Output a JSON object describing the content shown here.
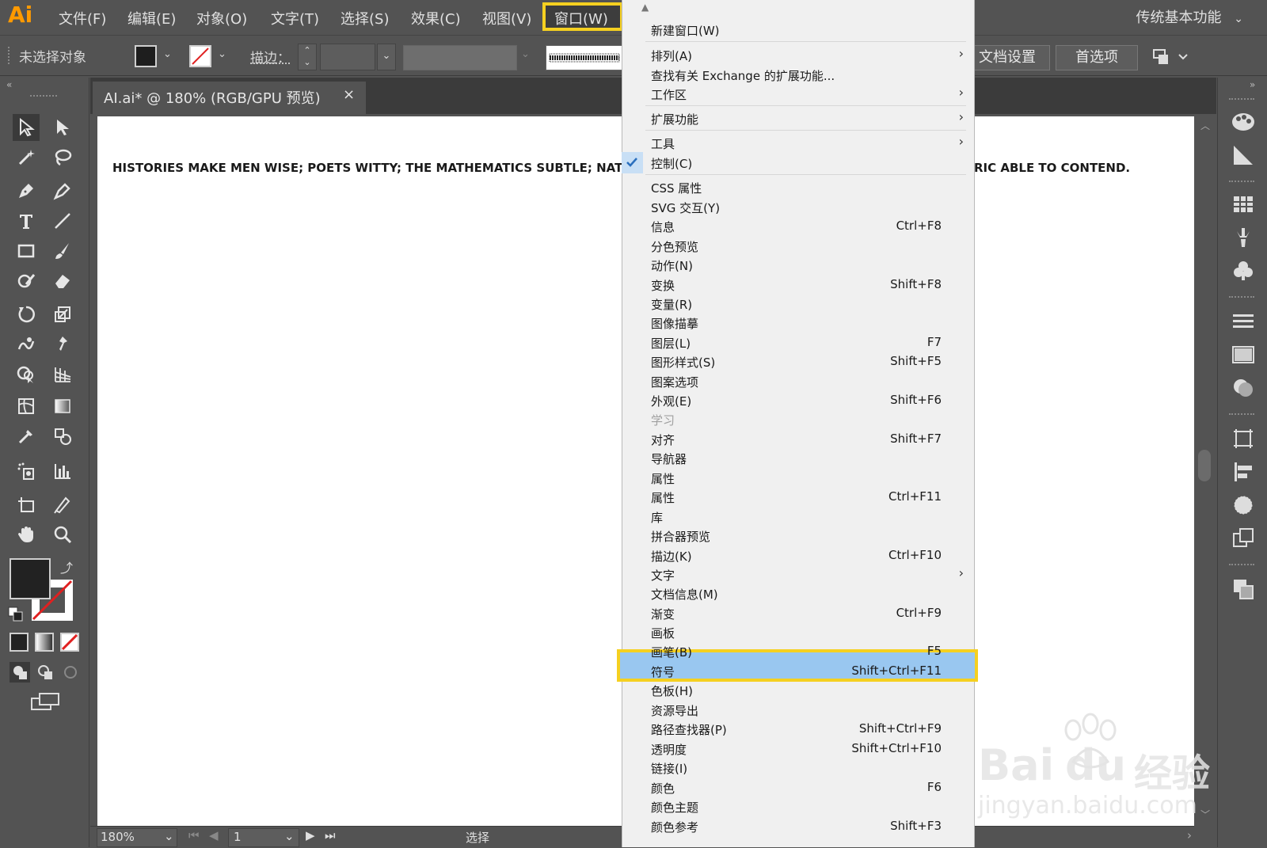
{
  "menubar": {
    "logo": "Ai",
    "items": [
      "文件(F)",
      "编辑(E)",
      "对象(O)",
      "文字(T)",
      "选择(S)",
      "效果(C)",
      "视图(V)",
      "窗口(W)"
    ],
    "workspace": "传统基本功能"
  },
  "controlbar": {
    "selection": "未选择对象",
    "stroke_label": "描边：",
    "doc_settings": "文档设置",
    "preferences": "首选项"
  },
  "tab": {
    "title": "AI.ai* @ 180% (RGB/GPU 预览)",
    "close": "×"
  },
  "canvas": {
    "text_left": "HISTORIES MAKE MEN WISE; POETS WITTY; THE MATHEMATICS SUBTLE; NATURAL",
    "text_right": "RIC ABLE TO CONTEND."
  },
  "statusbar": {
    "zoom": "180%",
    "page": "1",
    "tool": "选择"
  },
  "window_menu": {
    "items": [
      {
        "label": "新建窗口(W)",
        "shortcut": "",
        "submenu": false
      },
      {
        "label": "排列(A)",
        "shortcut": "",
        "submenu": true
      },
      {
        "label": "查找有关 Exchange 的扩展功能...",
        "shortcut": "",
        "submenu": false
      },
      {
        "label": "工作区",
        "shortcut": "",
        "submenu": true
      },
      {
        "label": "扩展功能",
        "shortcut": "",
        "submenu": true
      },
      {
        "label": "工具",
        "shortcut": "",
        "submenu": true
      },
      {
        "label": "控制(C)",
        "shortcut": "",
        "submenu": false,
        "checked": true
      },
      {
        "label": "CSS 属性",
        "shortcut": ""
      },
      {
        "label": "SVG 交互(Y)",
        "shortcut": ""
      },
      {
        "label": "信息",
        "shortcut": "Ctrl+F8"
      },
      {
        "label": "分色预览",
        "shortcut": ""
      },
      {
        "label": "动作(N)",
        "shortcut": ""
      },
      {
        "label": "变换",
        "shortcut": "Shift+F8"
      },
      {
        "label": "变量(R)",
        "shortcut": ""
      },
      {
        "label": "图像描摹",
        "shortcut": ""
      },
      {
        "label": "图层(L)",
        "shortcut": "F7"
      },
      {
        "label": "图形样式(S)",
        "shortcut": "Shift+F5"
      },
      {
        "label": "图案选项",
        "shortcut": ""
      },
      {
        "label": "外观(E)",
        "shortcut": "Shift+F6"
      },
      {
        "label": "学习",
        "shortcut": "",
        "disabled": true
      },
      {
        "label": "对齐",
        "shortcut": "Shift+F7"
      },
      {
        "label": "导航器",
        "shortcut": ""
      },
      {
        "label": "属性",
        "shortcut": ""
      },
      {
        "label": "属性",
        "shortcut": "Ctrl+F11"
      },
      {
        "label": "库",
        "shortcut": ""
      },
      {
        "label": "拼合器预览",
        "shortcut": ""
      },
      {
        "label": "描边(K)",
        "shortcut": "Ctrl+F10"
      },
      {
        "label": "文字",
        "shortcut": "",
        "submenu": true
      },
      {
        "label": "文档信息(M)",
        "shortcut": ""
      },
      {
        "label": "渐变",
        "shortcut": "Ctrl+F9"
      },
      {
        "label": "画板",
        "shortcut": ""
      },
      {
        "label": "画笔(B)",
        "shortcut": "F5",
        "highlighted": true
      },
      {
        "label": "符号",
        "shortcut": "Shift+Ctrl+F11"
      },
      {
        "label": "色板(H)",
        "shortcut": ""
      },
      {
        "label": "资源导出",
        "shortcut": ""
      },
      {
        "label": "路径查找器(P)",
        "shortcut": "Shift+Ctrl+F9"
      },
      {
        "label": "透明度",
        "shortcut": "Shift+Ctrl+F10"
      },
      {
        "label": "链接(I)",
        "shortcut": ""
      },
      {
        "label": "颜色",
        "shortcut": "F6"
      },
      {
        "label": "颜色主题",
        "shortcut": ""
      },
      {
        "label": "颜色参考",
        "shortcut": "Shift+F3"
      }
    ]
  },
  "watermark": {
    "brand": "Bai",
    "brand2": "du",
    "text": "经验",
    "url": "jingyan.baidu.com"
  },
  "colors": {
    "accent_highlight": "#f5d020",
    "menu_selected": "#99c7f0",
    "logo": "#ff9a00"
  }
}
